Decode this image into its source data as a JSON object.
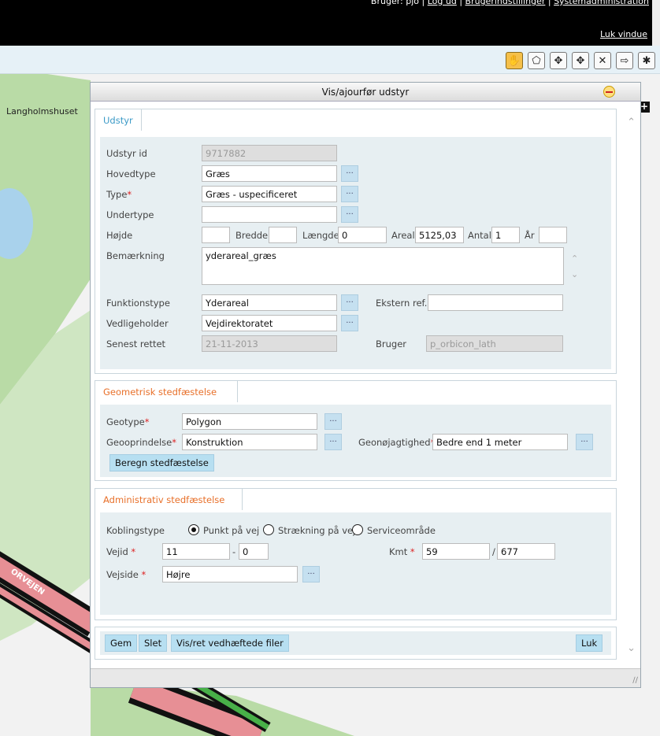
{
  "header": {
    "user_prefix": "Bruger: pjo |",
    "logout": "Log ud",
    "settings": "Brugerindstillinger",
    "sysadmin": "Systemadministration",
    "close_window": "Luk vindue"
  },
  "toolbar": {
    "tools": [
      "hand-pan-icon",
      "select-polygon-icon",
      "move-icon",
      "move-vertex-icon",
      "delete-icon",
      "add-node-icon",
      "split-icon"
    ]
  },
  "map": {
    "place_label": "Langholmshuset",
    "road_label": "ORVEJEN"
  },
  "dialog": {
    "title": "Vis/ajourfør udstyr",
    "udstyr": {
      "tab": "Udstyr",
      "labels": {
        "id": "Udstyr id",
        "hovedtype": "Hovedtype",
        "type": "Type",
        "undertype": "Undertype",
        "hojde": "Højde",
        "bredde": "Bredde",
        "laengde": "Længde",
        "areal": "Areal",
        "antal": "Antal",
        "aar": "År",
        "bemaerkning": "Bemærkning",
        "funktionstype": "Funktionstype",
        "ekstern": "Ekstern ref.",
        "vedligeholder": "Vedligeholder",
        "senest": "Senest rettet",
        "bruger": "Bruger"
      },
      "values": {
        "id": "9717882",
        "hovedtype": "Græs",
        "type": "Græs - uspecificeret",
        "undertype": "",
        "hojde": "",
        "bredde": "",
        "laengde": "0",
        "areal": "5125,03",
        "antal": "1",
        "aar": "",
        "bemaerkning": "yderareal_græs",
        "funktionstype": "Yderareal",
        "ekstern": "",
        "vedligeholder": "Vejdirektoratet",
        "senest": "21-11-2013",
        "bruger": "p_orbicon_lath"
      }
    },
    "geometrisk": {
      "tab": "Geometrisk stedfæstelse",
      "labels": {
        "geotype": "Geotype",
        "geooprindelse": "Geooprindelse",
        "geonoejagtighed": "Geonøjagtighed"
      },
      "values": {
        "geotype": "Polygon",
        "geooprindelse": "Konstruktion",
        "geonoejagtighed": "Bedre end 1 meter"
      },
      "calc_button": "Beregn stedfæstelse"
    },
    "administrativ": {
      "tab": "Administrativ stedfæstelse",
      "labels": {
        "koblingstype": "Koblingstype",
        "vejid": "Vejid",
        "kmt": "Kmt",
        "vejside": "Vejside"
      },
      "radios": [
        "Punkt på vej",
        "Strækning på vej",
        "Serviceområde"
      ],
      "values": {
        "vejid_a": "11",
        "vejid_b": "0",
        "kmt_a": "59",
        "kmt_b": "677",
        "vejside": "Højre"
      },
      "dash": "-",
      "slash": "/"
    },
    "buttons": {
      "gem": "Gem",
      "slet": "Slet",
      "files": "Vis/ret vedhæftede filer",
      "luk": "Luk"
    },
    "dots": "..."
  },
  "colors": {
    "header_bg": "#000000",
    "tab_text": "#e8702a",
    "tab_text_active": "#3b9ac7",
    "panel_bg": "#e7eff2",
    "button_bg": "#b7dff1"
  }
}
